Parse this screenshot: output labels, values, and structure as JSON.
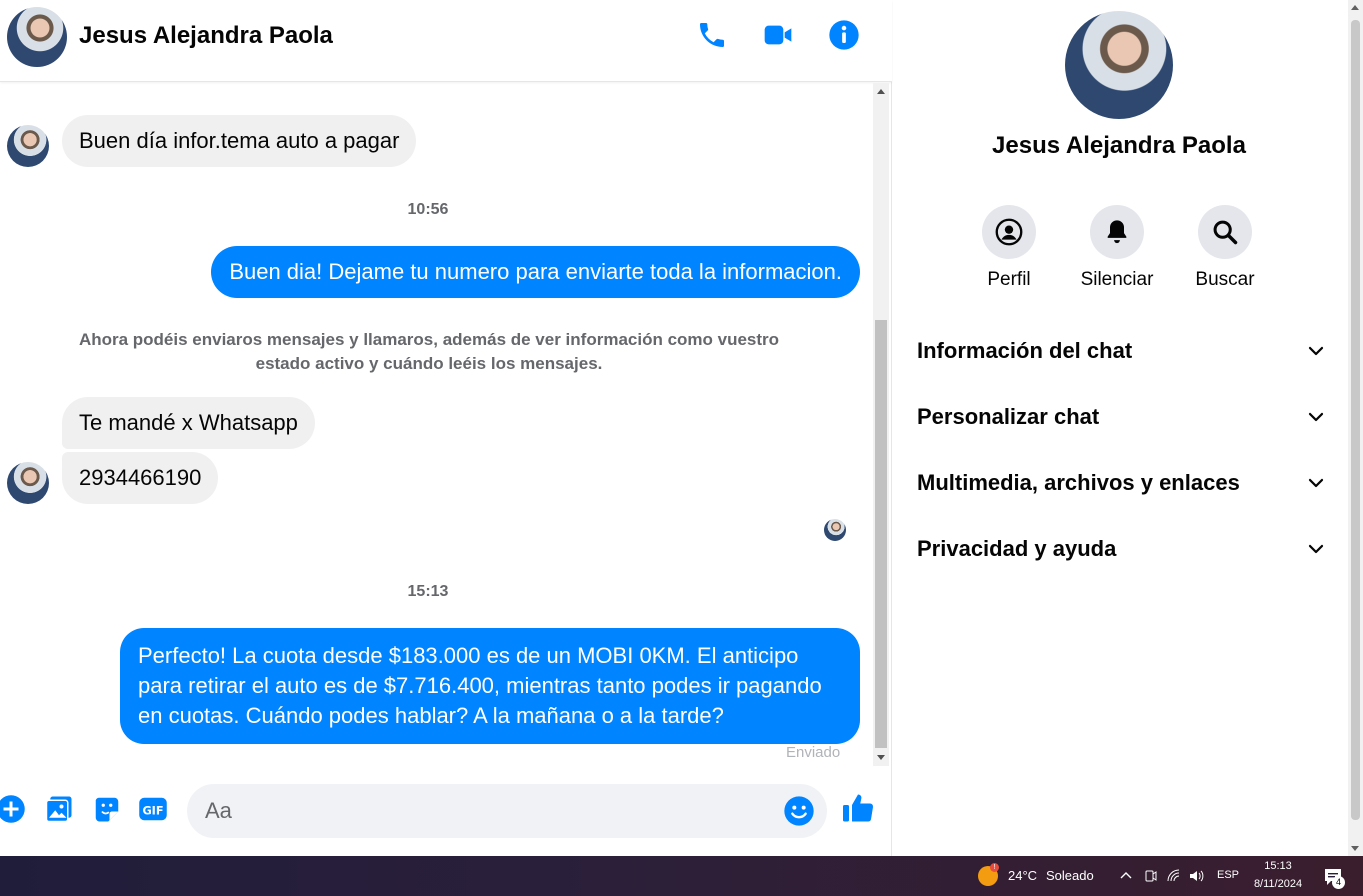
{
  "contact": {
    "name": "Jesus Alejandra Paola"
  },
  "messages": {
    "in1": "Buen día infor.tema auto a pagar",
    "time1": "10:56",
    "out1": "Buen dia! Dejame tu numero para enviarte toda la informacion.",
    "notice": "Ahora podéis enviaros mensajes y llamaros, además de ver información como vuestro estado activo y cuándo leéis los mensajes.",
    "in2": "Te mandé x Whatsapp",
    "in3": "2934466190",
    "time2": "15:13",
    "out2": "Perfecto! La cuota desde $183.000 es de un MOBI 0KM. El anticipo para retirar el auto es de $7.716.400, mientras tanto podes ir pagando en cuotas. Cuándo podes hablar? A la mañana o a la tarde?",
    "status": "Enviado"
  },
  "composer": {
    "placeholder": "Aa"
  },
  "info_panel": {
    "actions": {
      "profile": "Perfil",
      "mute": "Silenciar",
      "search": "Buscar"
    },
    "sections": {
      "chat_info": "Información del chat",
      "customize": "Personalizar chat",
      "media": "Multimedia, archivos y enlaces",
      "privacy": "Privacidad y ayuda"
    }
  },
  "taskbar": {
    "temp": "24°C",
    "weather": "Soleado",
    "weather_badge": "!",
    "lang": "ESP",
    "time": "15:13",
    "date": "8/11/2024",
    "notifications": "4"
  },
  "colors": {
    "accent": "#0084ff",
    "bubble_in": "#f0f0f0",
    "secondary_text": "#65676b"
  },
  "icons": {
    "header": [
      "phone-icon",
      "video-camera-icon",
      "info-icon"
    ],
    "composer": [
      "plus-icon",
      "gallery-icon",
      "sticker-icon",
      "gif-icon",
      "emoji-icon",
      "thumbs-up-icon"
    ],
    "info": [
      "profile-icon",
      "bell-icon",
      "search-icon",
      "chevron-down-icon"
    ]
  }
}
